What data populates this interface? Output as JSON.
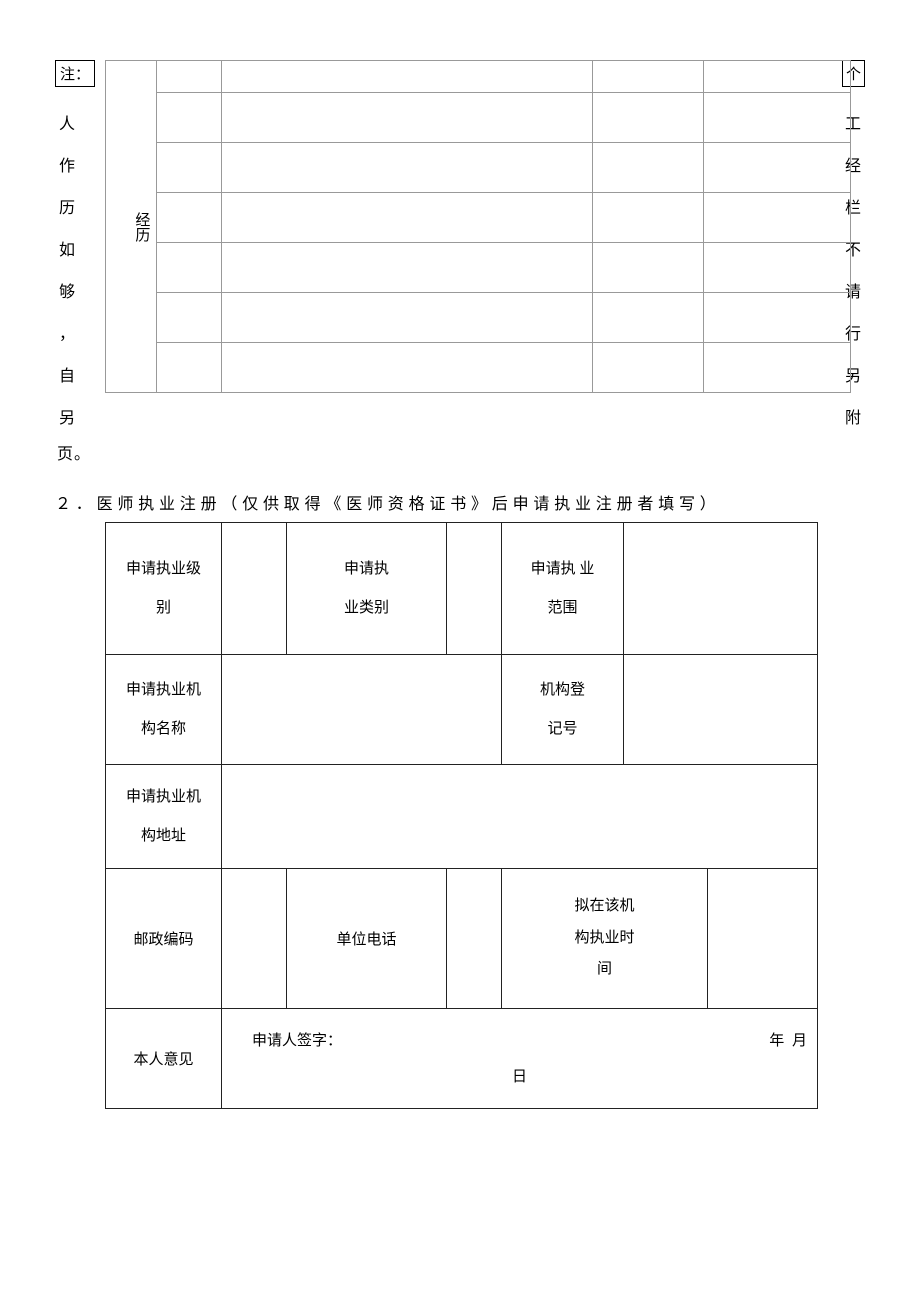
{
  "note": {
    "label": "注：",
    "left_chars": [
      "人",
      "作",
      "历",
      "如",
      "够",
      "，",
      "自",
      "另"
    ],
    "ge_box": [
      "个"
    ],
    "right_chars": [
      "工",
      "经",
      "栏",
      "不",
      "请",
      "行",
      "另",
      "附"
    ],
    "tail": "页。"
  },
  "experience": {
    "side_label": "经历",
    "rows": [
      {
        "c1": "",
        "c2": "",
        "c3": "",
        "c4": ""
      },
      {
        "c1": "",
        "c2": "",
        "c3": "",
        "c4": ""
      },
      {
        "c1": "",
        "c2": "",
        "c3": "",
        "c4": ""
      },
      {
        "c1": "",
        "c2": "",
        "c3": "",
        "c4": ""
      },
      {
        "c1": "",
        "c2": "",
        "c3": "",
        "c4": ""
      },
      {
        "c1": "",
        "c2": "",
        "c3": "",
        "c4": ""
      },
      {
        "c1": "",
        "c2": "",
        "c3": "",
        "c4": ""
      }
    ]
  },
  "section2": {
    "heading": "２．医师执业注册（仅供取得《医师资格证书》后申请执业注册者填写）",
    "row1": {
      "level_label": "申请执业级别",
      "level_value": "",
      "category_label": "申请执业类别",
      "category_value": "",
      "scope_label": "申请执 业范围",
      "scope_value": ""
    },
    "row2": {
      "org_name_label": "申请执业机构名称",
      "org_name_value": "",
      "org_reg_label": "机构登记号",
      "org_reg_value": ""
    },
    "row3": {
      "org_addr_label": "申请执业机构地址",
      "org_addr_value": ""
    },
    "row4": {
      "post_label": "邮政编码",
      "post_value": "",
      "phone_label": "单位电话",
      "phone_value": "",
      "duration_label": "拟在该机构执业时间",
      "duration_value": ""
    },
    "row5": {
      "opinion_label": "本人意见",
      "sign_label": "申请人签字：",
      "date_label": "年 月",
      "day_label": "日"
    }
  }
}
